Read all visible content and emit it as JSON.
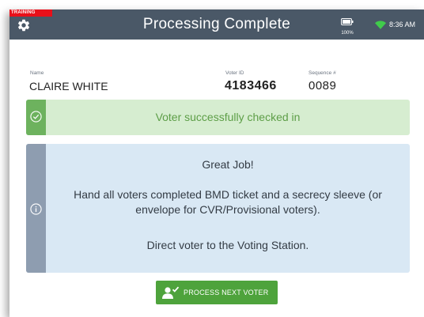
{
  "header": {
    "training_label": "TRAINING",
    "title": "Processing Complete",
    "battery_percent": "100%",
    "time": "8:36 AM"
  },
  "voter": {
    "name_label": "Name",
    "name": "CLAIRE WHITE",
    "voter_id_label": "Voter ID",
    "voter_id": "4183466",
    "sequence_label": "Sequence #",
    "sequence": "0089"
  },
  "success_alert": {
    "message": "Voter successfully checked in"
  },
  "info_panel": {
    "heading": "Great Job!",
    "instructions": "Hand all voters completed BMD ticket and a secrecy sleeve (or envelope for CVR/Provisional voters).",
    "direction": "Direct voter to the Voting Station."
  },
  "actions": {
    "process_next_label": "PROCESS NEXT VOTER"
  },
  "colors": {
    "header_bg": "#4a5867",
    "training_red": "#e8101a",
    "success_green": "#6db25e",
    "success_bg": "#d6edd0",
    "info_bg": "#d9e8f4",
    "info_side": "#8e9db0",
    "button_green": "#4ea33c"
  },
  "icons": [
    "gear-icon",
    "battery-icon",
    "wifi-icon",
    "check-circle-icon",
    "info-circle-icon",
    "user-check-icon"
  ]
}
